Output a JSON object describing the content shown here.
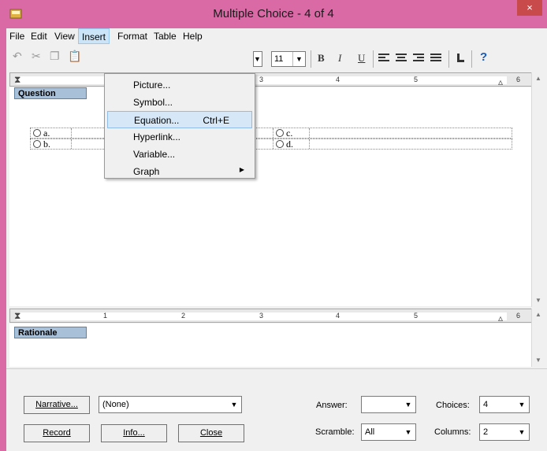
{
  "window": {
    "title": "Multiple Choice - 4 of 4",
    "close_glyph": "×"
  },
  "menubar": {
    "items": [
      "File",
      "Edit",
      "View",
      "Insert",
      "Format",
      "Table",
      "Help"
    ],
    "active": "Insert"
  },
  "insert_menu": {
    "items": [
      {
        "label": "Picture...",
        "shortcut": "",
        "submenu": false
      },
      {
        "label": "Symbol...",
        "shortcut": "",
        "submenu": false
      },
      {
        "label": "Equation...",
        "shortcut": "Ctrl+E",
        "submenu": false
      },
      {
        "label": "Hyperlink...",
        "shortcut": "",
        "submenu": false
      },
      {
        "label": "Variable...",
        "shortcut": "",
        "submenu": false
      },
      {
        "label": "Graph",
        "shortcut": "",
        "submenu": true
      }
    ],
    "highlighted_index": 2
  },
  "toolbar": {
    "font_size": "11",
    "bold": "B",
    "italic": "I",
    "underline": "U",
    "help_glyph": "?"
  },
  "ruler": {
    "numbers": [
      "1",
      "2",
      "3",
      "4",
      "5",
      "6"
    ]
  },
  "question": {
    "label": "Question",
    "choices": [
      "a.",
      "b.",
      "c.",
      "d."
    ]
  },
  "rationale": {
    "label": "Rationale"
  },
  "bottom": {
    "narrative_button": "Narrative...",
    "narrative_value": "(None)",
    "record_button": "Record",
    "info_button": "Info...",
    "close_button": "Close",
    "answer_label": "Answer:",
    "answer_value": "",
    "scramble_label": "Scramble:",
    "scramble_value": "All",
    "choices_label": "Choices:",
    "choices_value": "4",
    "columns_label": "Columns:",
    "columns_value": "2"
  },
  "colors": {
    "title_bar": "#d96aa6",
    "menu_highlight": "#d6e8f8",
    "section_label": "#a8c0d8"
  }
}
